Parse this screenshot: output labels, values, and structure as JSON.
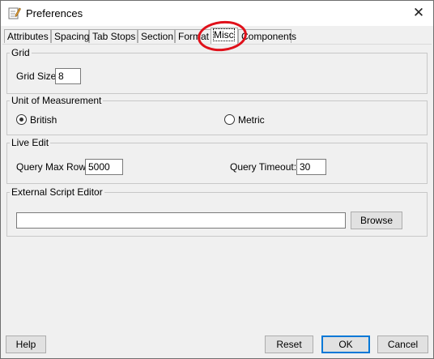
{
  "window": {
    "title": "Preferences",
    "close_glyph": "✕"
  },
  "tabs": [
    {
      "label": "Attributes"
    },
    {
      "label": "Spacing"
    },
    {
      "label": "Tab Stops"
    },
    {
      "label": "Section"
    },
    {
      "label": "Format"
    },
    {
      "label": "Misc",
      "active": true
    },
    {
      "label": "Components"
    }
  ],
  "grid": {
    "legend": "Grid",
    "size_label": "Grid Size:",
    "size_value": "8"
  },
  "units": {
    "legend": "Unit of Measurement",
    "british_label": "British",
    "metric_label": "Metric",
    "selected": "British"
  },
  "live_edit": {
    "legend": "Live Edit",
    "max_row_label": "Query Max Row:",
    "max_row_value": "5000",
    "timeout_label": "Query Timeout:",
    "timeout_value": "30"
  },
  "script_editor": {
    "legend": "External Script Editor",
    "path_value": "",
    "browse_label": "Browse"
  },
  "buttons": {
    "help": "Help",
    "reset": "Reset",
    "ok": "OK",
    "cancel": "Cancel"
  },
  "colors": {
    "highlight": "#e0101a",
    "default_button_border": "#0078d7"
  },
  "icons": {
    "app": "preferences-icon",
    "close": "close-icon"
  }
}
